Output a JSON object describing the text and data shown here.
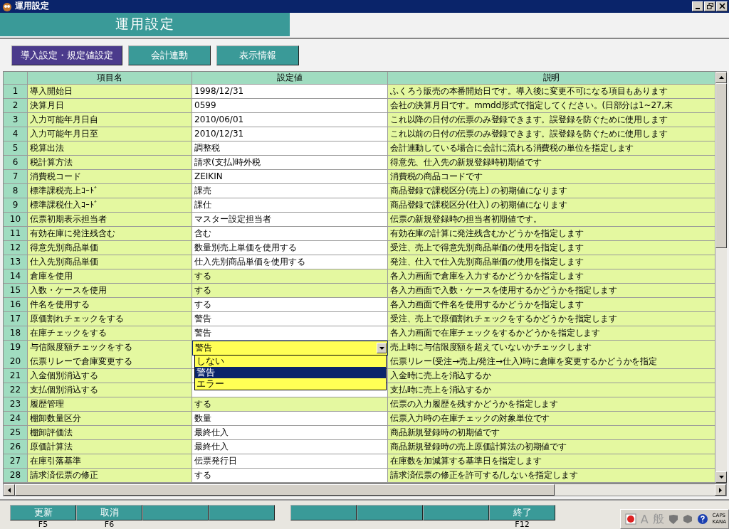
{
  "window": {
    "title": "運用設定"
  },
  "header": {
    "title": "運用設定"
  },
  "tabs": [
    {
      "label": "導入設定・規定値設定",
      "selected": true
    },
    {
      "label": "会計連動",
      "selected": false
    },
    {
      "label": "表示情報",
      "selected": false
    }
  ],
  "table": {
    "columns": [
      "項目名",
      "設定値",
      "説明"
    ],
    "rows": [
      {
        "no": "1",
        "item": "導入開始日",
        "value": "1998/12/31",
        "locked": false,
        "description": "ふくろう販売の本番開始日です。導入後に変更不可になる項目もあります"
      },
      {
        "no": "2",
        "item": "決算月日",
        "value": "0599",
        "locked": false,
        "description": "会社の決算月日です。mmdd形式で指定してください。(日部分は1~27,末"
      },
      {
        "no": "3",
        "item": "入力可能年月日自",
        "value": "2010/06/01",
        "locked": false,
        "description": "これ以降の日付の伝票のみ登録できます。誤登録を防ぐために使用します"
      },
      {
        "no": "4",
        "item": "入力可能年月日至",
        "value": "2010/12/31",
        "locked": false,
        "description": "これ以前の日付の伝票のみ登録できます。誤登録を防ぐために使用します"
      },
      {
        "no": "5",
        "item": "税算出法",
        "value": "調整税",
        "locked": false,
        "description": "会計連動している場合に会計に流れる消費税の単位を指定します"
      },
      {
        "no": "6",
        "item": "税計算方法",
        "value": "請求(支払)時外税",
        "locked": false,
        "description": "得意先、仕入先の新規登録時初期値です"
      },
      {
        "no": "7",
        "item": "消費税コード",
        "value": "ZEIKIN",
        "locked": false,
        "description": "消費税の商品コードです"
      },
      {
        "no": "8",
        "item": "標準課税売上ｺｰﾄﾞ",
        "value": "課売",
        "locked": false,
        "description": "商品登録で課税区分(売上) の初期値になります"
      },
      {
        "no": "9",
        "item": "標準課税仕入ｺｰﾄﾞ",
        "value": "課仕",
        "locked": false,
        "description": "商品登録で課税区分(仕入) の初期値になります"
      },
      {
        "no": "10",
        "item": "伝票初期表示担当者",
        "value": "マスター設定担当者",
        "locked": false,
        "description": "伝票の新規登録時の担当者初期値です。"
      },
      {
        "no": "11",
        "item": "有効在庫に発注残含む",
        "value": "含む",
        "locked": false,
        "description": "有効在庫の計算に発注残含むかどうかを指定します"
      },
      {
        "no": "12",
        "item": "得意先別商品単価",
        "value": "数量別売上単価を使用する",
        "locked": false,
        "description": "受注、売上で得意先別商品単価の使用を指定します"
      },
      {
        "no": "13",
        "item": "仕入先別商品単価",
        "value": "仕入先別商品単価を使用する",
        "locked": false,
        "description": "発注、仕入で仕入先別商品単価の使用を指定します"
      },
      {
        "no": "14",
        "item": "倉庫を使用",
        "value": "する",
        "locked": true,
        "description": "各入力画面で倉庫を入力するかどうかを指定します"
      },
      {
        "no": "15",
        "item": "入数・ケースを使用",
        "value": "する",
        "locked": true,
        "description": "各入力画面で入数・ケースを使用するかどうかを指定します"
      },
      {
        "no": "16",
        "item": "件名を使用する",
        "value": "する",
        "locked": false,
        "description": "各入力画面で件名を使用するかどうかを指定します"
      },
      {
        "no": "17",
        "item": "原価割れチェックをする",
        "value": "警告",
        "locked": false,
        "description": "受注、売上で原価割れチェックをするかどうかを指定します"
      },
      {
        "no": "18",
        "item": "在庫チェックをする",
        "value": "警告",
        "locked": false,
        "description": "各入力画面で在庫チェックをするかどうかを指定します"
      },
      {
        "no": "19",
        "item": "与信限度額チェックをする",
        "value": "警告",
        "dropdown": {
          "options": [
            {
              "label": "しない",
              "selected": false
            },
            {
              "label": "警告",
              "selected": true
            },
            {
              "label": "エラー",
              "selected": false
            }
          ]
        },
        "description": "売上時に与信限度額を超えていないかチェックします"
      },
      {
        "no": "20",
        "item": "伝票リレーで倉庫変更する",
        "description": "伝票リレー(受注→売上/発注→仕入)時に倉庫を変更するかどうかを指定"
      },
      {
        "no": "21",
        "item": "入金個別消込する",
        "description": "入金時に売上を消込するか"
      },
      {
        "no": "22",
        "item": "支払個別消込する",
        "locked": false,
        "description": "支払時に売上を消込するか"
      },
      {
        "no": "23",
        "item": "履歴管理",
        "value": "する",
        "locked": true,
        "description": "伝票の入力履歴を残すかどうかを指定します"
      },
      {
        "no": "24",
        "item": "棚卸数量区分",
        "value": "数量",
        "locked": false,
        "description": "伝票入力時の在庫チェックの対象単位です"
      },
      {
        "no": "25",
        "item": "棚卸評価法",
        "value": "最終仕入",
        "locked": false,
        "description": "商品新規登録時の初期値です"
      },
      {
        "no": "26",
        "item": "原価計算法",
        "value": "最終仕入",
        "locked": false,
        "description": "商品新規登録時の売上原価計算法の初期値です"
      },
      {
        "no": "27",
        "item": "在庫引落基準",
        "value": "伝票発行日",
        "locked": false,
        "description": "在庫数を加減算する基準日を指定します"
      },
      {
        "no": "28",
        "item": "請求済伝票の修正",
        "value": "する",
        "locked": false,
        "description": "請求済伝票の修正を許可する/しないを指定します"
      }
    ]
  },
  "function_keys": [
    [
      {
        "kind": "key",
        "label": "更新",
        "key": "F5"
      },
      {
        "kind": "key",
        "label": "取消",
        "key": "F6"
      },
      {
        "kind": "blank"
      },
      {
        "kind": "blank"
      }
    ],
    [
      {
        "kind": "blank"
      },
      {
        "kind": "blank"
      },
      {
        "kind": "blank"
      },
      {
        "kind": "key",
        "label": "終了",
        "key": "F12"
      }
    ]
  ],
  "tray": {
    "ime_mode": [
      "A",
      "般"
    ],
    "caps": "CAPS",
    "kana": "KANA"
  }
}
